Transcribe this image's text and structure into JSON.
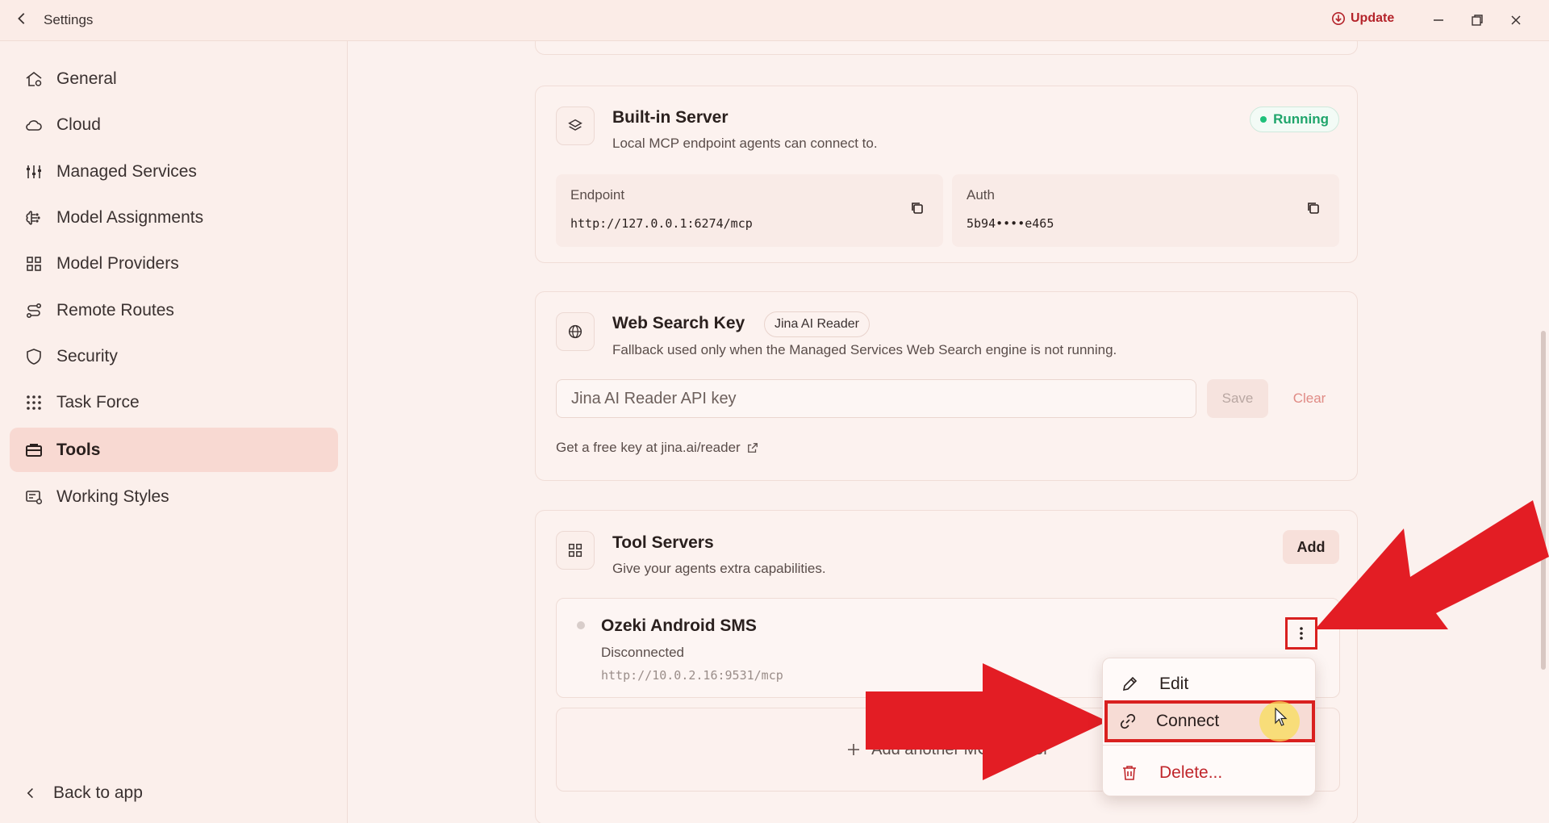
{
  "titlebar": {
    "title": "Settings",
    "update_label": "Update"
  },
  "sidebar": {
    "items": [
      {
        "label": "General",
        "icon": "home-gear-icon"
      },
      {
        "label": "Cloud",
        "icon": "cloud-icon"
      },
      {
        "label": "Managed Services",
        "icon": "sliders-icon"
      },
      {
        "label": "Model Assignments",
        "icon": "brain-icon"
      },
      {
        "label": "Model Providers",
        "icon": "grid-icon"
      },
      {
        "label": "Remote Routes",
        "icon": "route-icon"
      },
      {
        "label": "Security",
        "icon": "shield-icon"
      },
      {
        "label": "Task Force",
        "icon": "dots-grid-icon"
      },
      {
        "label": "Tools",
        "icon": "toolbox-icon",
        "active": true
      },
      {
        "label": "Working Styles",
        "icon": "style-card-icon"
      }
    ],
    "back_label": "Back to app"
  },
  "builtin_server": {
    "title": "Built-in Server",
    "subtitle": "Local MCP endpoint agents can connect to.",
    "status": "Running",
    "endpoint_label": "Endpoint",
    "endpoint_value": "http://127.0.0.1:6274/mcp",
    "auth_label": "Auth",
    "auth_value": "5b94••••e465"
  },
  "web_search": {
    "title": "Web Search Key",
    "provider": "Jina AI Reader",
    "subtitle": "Fallback used only when the Managed Services Web Search engine is not running.",
    "input_placeholder": "Jina AI Reader API key",
    "save_label": "Save",
    "clear_label": "Clear",
    "link_text": "Get a free key at jina.ai/reader"
  },
  "tool_servers": {
    "title": "Tool Servers",
    "subtitle": "Give your agents extra capabilities.",
    "add_label": "Add",
    "servers": [
      {
        "name": "Ozeki Android SMS",
        "status": "Disconnected",
        "url": "http://10.0.2.16:9531/mcp"
      }
    ],
    "add_another_label": "Add another MCP server"
  },
  "context_menu": {
    "edit_label": "Edit",
    "connect_label": "Connect",
    "delete_label": "Delete..."
  },
  "colors": {
    "accent_red": "#d9201f",
    "running_green": "#1fa56b",
    "active_nav_bg": "#f8d9d2"
  }
}
